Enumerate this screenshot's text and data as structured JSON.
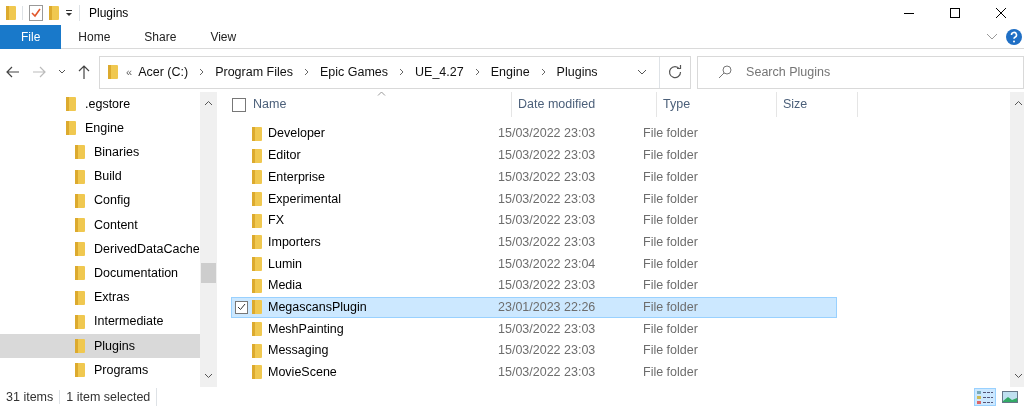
{
  "window": {
    "title": "Plugins"
  },
  "ribbon": {
    "tabs": [
      {
        "label": "File",
        "kind": "file"
      },
      {
        "label": "Home",
        "kind": "tab"
      },
      {
        "label": "Share",
        "kind": "tab"
      },
      {
        "label": "View",
        "kind": "tab"
      }
    ]
  },
  "address": {
    "overflow": "«",
    "crumbs": [
      "Acer (C:)",
      "Program Files",
      "Epic Games",
      "UE_4.27",
      "Engine",
      "Plugins"
    ]
  },
  "search": {
    "placeholder": "Search Plugins"
  },
  "nav": {
    "items": [
      {
        "label": ".egstore",
        "selected": false
      },
      {
        "label": "Engine",
        "selected": false,
        "children": [
          {
            "label": "Binaries",
            "selected": false
          },
          {
            "label": "Build",
            "selected": false
          },
          {
            "label": "Config",
            "selected": false
          },
          {
            "label": "Content",
            "selected": false
          },
          {
            "label": "DerivedDataCache",
            "selected": false
          },
          {
            "label": "Documentation",
            "selected": false
          },
          {
            "label": "Extras",
            "selected": false
          },
          {
            "label": "Intermediate",
            "selected": false
          },
          {
            "label": "Plugins",
            "selected": true
          },
          {
            "label": "Programs",
            "selected": false
          }
        ]
      }
    ]
  },
  "select_all": {
    "checked": false
  },
  "columns": [
    {
      "label": "Name",
      "sorted": true
    },
    {
      "label": "Date modified",
      "sorted": false
    },
    {
      "label": "Type",
      "sorted": false
    },
    {
      "label": "Size",
      "sorted": false
    }
  ],
  "rows": [
    {
      "name": "Developer",
      "date": "15/03/2022 23:03",
      "type": "File folder",
      "selected": false
    },
    {
      "name": "Editor",
      "date": "15/03/2022 23:03",
      "type": "File folder",
      "selected": false
    },
    {
      "name": "Enterprise",
      "date": "15/03/2022 23:03",
      "type": "File folder",
      "selected": false
    },
    {
      "name": "Experimental",
      "date": "15/03/2022 23:03",
      "type": "File folder",
      "selected": false
    },
    {
      "name": "FX",
      "date": "15/03/2022 23:03",
      "type": "File folder",
      "selected": false
    },
    {
      "name": "Importers",
      "date": "15/03/2022 23:03",
      "type": "File folder",
      "selected": false
    },
    {
      "name": "Lumin",
      "date": "15/03/2022 23:04",
      "type": "File folder",
      "selected": false
    },
    {
      "name": "Media",
      "date": "15/03/2022 23:03",
      "type": "File folder",
      "selected": false
    },
    {
      "name": "MegascansPlugin",
      "date": "23/01/2023 22:26",
      "type": "File folder",
      "selected": true
    },
    {
      "name": "MeshPainting",
      "date": "15/03/2022 23:03",
      "type": "File folder",
      "selected": false
    },
    {
      "name": "Messaging",
      "date": "15/03/2022 23:03",
      "type": "File folder",
      "selected": false
    },
    {
      "name": "MovieScene",
      "date": "15/03/2022 23:03",
      "type": "File folder",
      "selected": false
    }
  ],
  "status": {
    "count": "31 items",
    "selection": "1 item selected"
  },
  "views": [
    {
      "kind": "details",
      "selected": true
    },
    {
      "kind": "large-icons",
      "selected": false
    }
  ]
}
